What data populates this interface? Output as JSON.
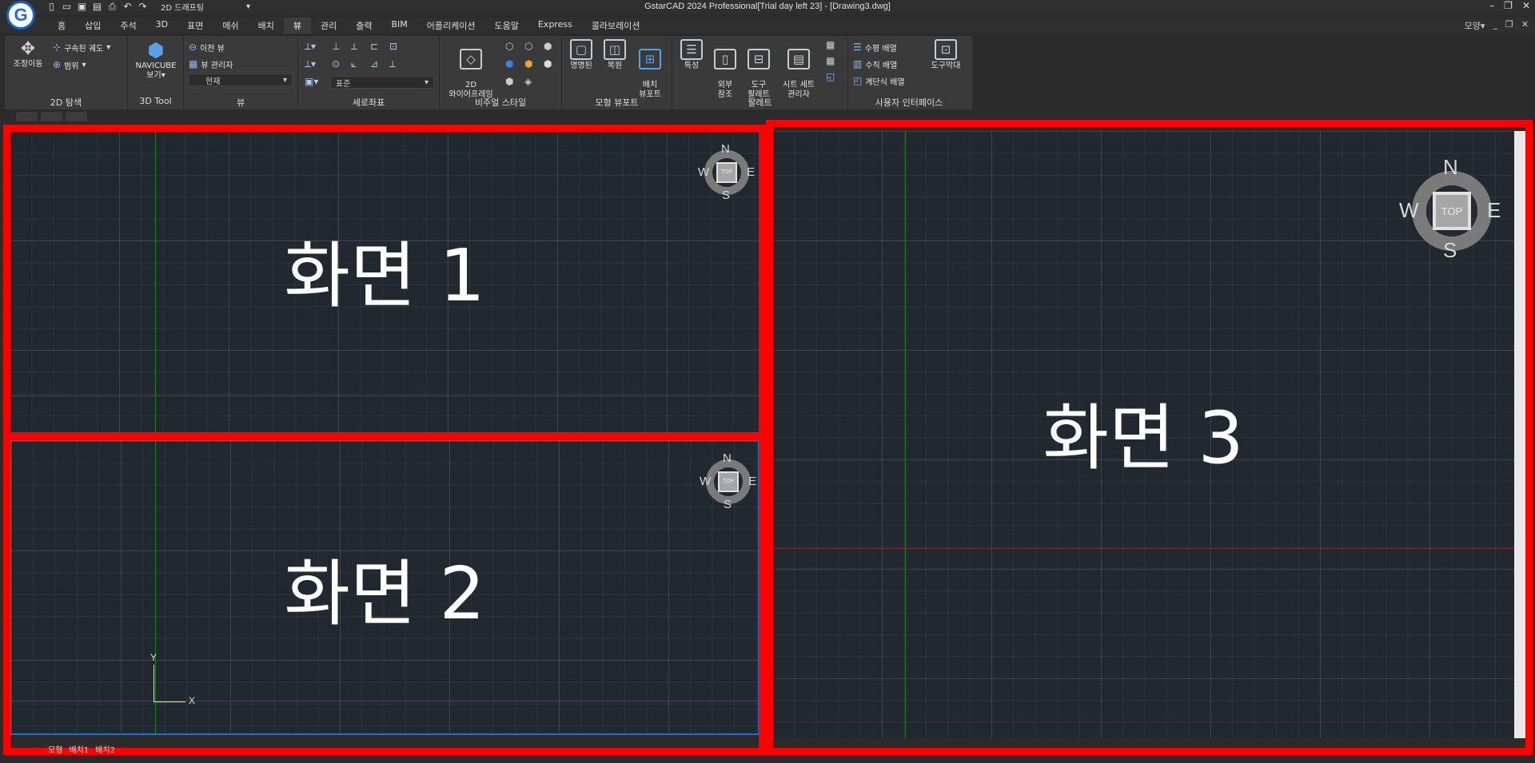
{
  "title_bar": {
    "app_logo_letter": "G",
    "workspace": "2D 드래프팅",
    "title": "GstarCAD 2024 Professional[Trial day left 23] - [Drawing3.dwg]"
  },
  "menu": {
    "tabs": [
      "홈",
      "삽입",
      "주석",
      "3D",
      "표면",
      "메쉬",
      "배치",
      "뷰",
      "관리",
      "출력",
      "BIM",
      "어플리케이션",
      "도움말",
      "Express",
      "콜라보레이션"
    ],
    "active_tab": "뷰",
    "right_label": "모양"
  },
  "ribbon": {
    "nav2d": {
      "pan_label": "조정이동",
      "orbit_label": "구속된 궤도",
      "extents_label": "범위",
      "panel_label": "2D 탐색"
    },
    "tool3d": {
      "navicube_label": "NAVICUBE",
      "navicube_sub": "보기",
      "panel_label": "3D Tool"
    },
    "view": {
      "prev_view": "이전 뷰",
      "view_manager": "뷰 관리자",
      "current": "현재",
      "panel_label": "뷰"
    },
    "coords": {
      "ucs_select": "표준",
      "panel_label": "세로좌표"
    },
    "visual_styles": {
      "wireframe_label": "2D\n와이어프레임",
      "panel_label": "비주얼 스타일"
    },
    "model_viewports": {
      "named": "명명된",
      "restore": "복원",
      "layout_viewport": "배치\n뷰포트",
      "panel_label": "모형 뷰포트"
    },
    "palettes": {
      "properties": "특성",
      "xref": "외부\n참조",
      "tool_palette": "도구\n팔레트",
      "sheet_set": "시트 세트\n관리자",
      "panel_label": "팔레트"
    },
    "ui": {
      "tile_h": "수평 배열",
      "tile_v": "수직 배열",
      "cascade": "계단식 배열",
      "toolbar": "도구막대",
      "panel_label": "사용자 인터페이스"
    }
  },
  "viewports": [
    {
      "label": "화면 1",
      "compass": {
        "n": "N",
        "s": "S",
        "e": "E",
        "w": "W",
        "top": "TOP"
      }
    },
    {
      "label": "화면 2",
      "compass": {
        "n": "N",
        "s": "S",
        "e": "E",
        "w": "W",
        "top": "TOP"
      },
      "ucs": {
        "x": "X",
        "y": "Y"
      }
    },
    {
      "label": "화면 3",
      "compass": {
        "n": "N",
        "s": "S",
        "e": "E",
        "w": "W",
        "top": "TOP"
      }
    }
  ],
  "layout_tabs": [
    "모형",
    "배치1",
    "배치2"
  ],
  "colors": {
    "highlight_box": "#ff0000",
    "active_viewport_border": "#1e6fd9",
    "canvas": "#212830"
  }
}
